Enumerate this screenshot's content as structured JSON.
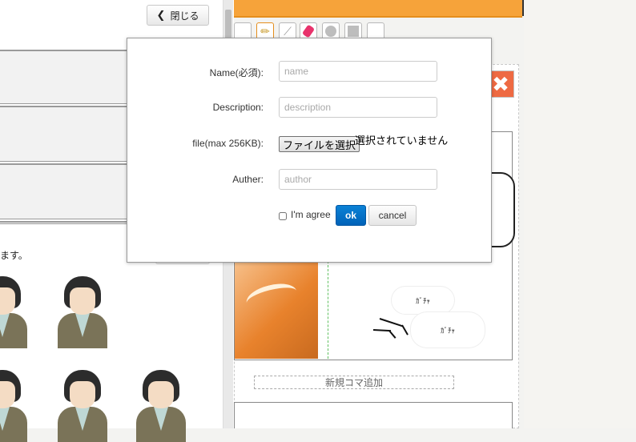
{
  "left_panel": {
    "close_label": "閉じる",
    "close_icon": "chevron-left-icon",
    "hint_text": "ます。"
  },
  "editor": {
    "add_panel_label": "新規コマ追加",
    "bubble_1_text": "ｶﾞﾁｬ",
    "bubble_2_text": "ｶﾞﾁｬ",
    "delete_icon": "close-icon",
    "accent_color": "#f6a33a",
    "delete_color": "#ee6a43"
  },
  "dialog": {
    "name_label": "Name(必須):",
    "name_placeholder": "name",
    "description_label": "Description:",
    "description_placeholder": "description",
    "file_label": "file(max 256KB):",
    "file_button": "ファイルを選択",
    "file_status": "選択されていません",
    "author_label": "Auther:",
    "author_placeholder": "author",
    "agree_label": "I'm agree",
    "ok_label": "ok",
    "cancel_label": "cancel",
    "ok_color": "#0b82d6"
  }
}
